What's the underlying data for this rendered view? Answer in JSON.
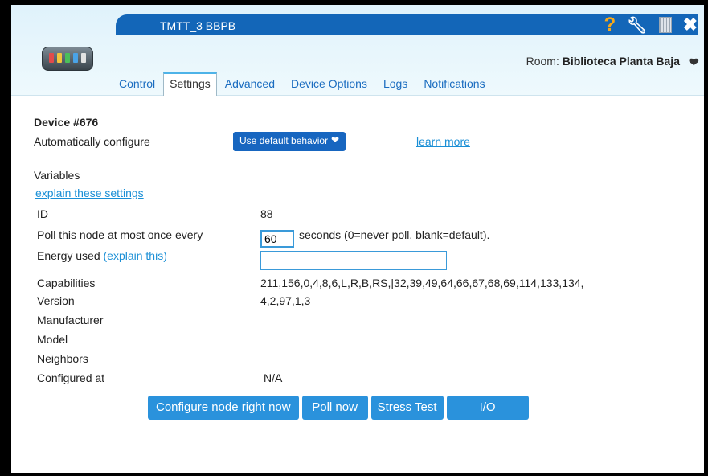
{
  "window": {
    "title": "TMTT_3 BBPB"
  },
  "header_icons": [
    "help-icon",
    "wrench-icon",
    "trash-icon",
    "close-icon"
  ],
  "room": {
    "label": "Room:",
    "name": "Biblioteca Planta Baja"
  },
  "tabs": [
    {
      "label": "Control",
      "active": false
    },
    {
      "label": "Settings",
      "active": true
    },
    {
      "label": "Advanced",
      "active": false
    },
    {
      "label": "Device Options",
      "active": false
    },
    {
      "label": "Logs",
      "active": false
    },
    {
      "label": "Notifications",
      "active": false
    }
  ],
  "device": {
    "title": "Device #676",
    "auto_config_label": "Automatically configure",
    "auto_config_value": "Use default behavior",
    "learn_more": "learn more"
  },
  "variables": {
    "heading": "Variables",
    "explain_link": "explain these settings",
    "id_label": "ID",
    "id_value": "88",
    "poll_label": "Poll this node at most once every",
    "poll_value": "60",
    "poll_suffix": "seconds (0=never poll, blank=default).",
    "energy_label": "Energy used",
    "energy_link": "(explain this)",
    "energy_value": "",
    "capabilities_label": "Capabilities",
    "capabilities_value": "211,156,0,4,8,6,L,R,B,RS,|32,39,49,64,66,67,68,69,114,133,134,",
    "version_label": "Version",
    "version_value": "4,2,97,1,3",
    "manufacturer_label": "Manufacturer",
    "model_label": "Model",
    "neighbors_label": "Neighbors",
    "configured_label": "Configured at",
    "configured_value": "N/A"
  },
  "actions": {
    "configure": "Configure node right now",
    "poll": "Poll now",
    "stress": "Stress Test",
    "io": "I/O"
  },
  "colors": {
    "title_bar": "#1366b8",
    "link": "#1a8fd6",
    "button": "#2a92dc",
    "help": "#f7a91a"
  }
}
